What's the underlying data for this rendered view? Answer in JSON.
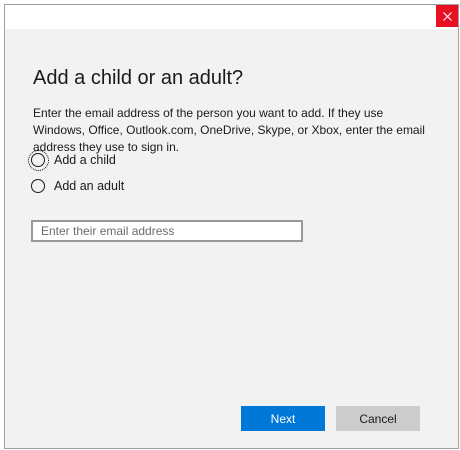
{
  "window": {
    "close_icon": "close-icon",
    "close_color": "#e81123"
  },
  "dialog": {
    "title": "Add a child or an adult?",
    "description": "Enter the email address of the person you want to add. If they use Windows, Office, Outlook.com, OneDrive, Skype, or Xbox, enter the email address they use to sign in.",
    "options": [
      {
        "label": "Add a child",
        "focused": true,
        "selected": false
      },
      {
        "label": "Add an adult",
        "focused": false,
        "selected": false
      }
    ],
    "email": {
      "value": "",
      "placeholder": "Enter their email address"
    }
  },
  "buttons": {
    "next_label": "Next",
    "cancel_label": "Cancel",
    "accent": "#0078d7"
  }
}
